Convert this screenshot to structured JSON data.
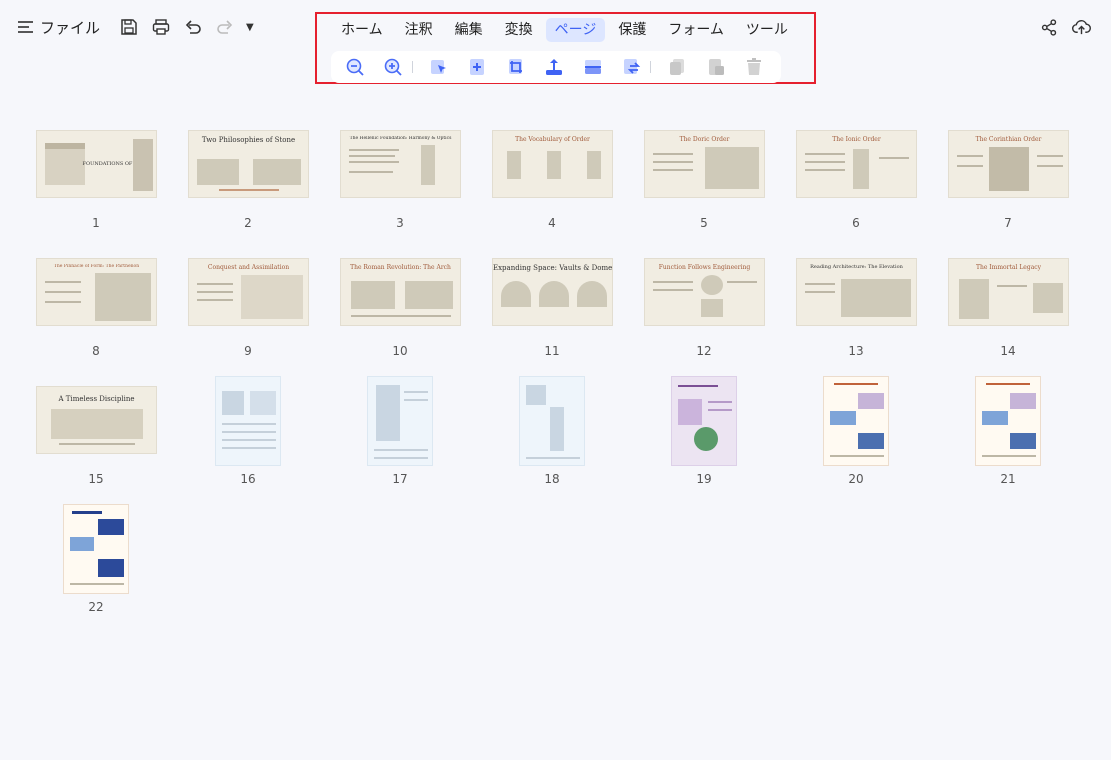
{
  "toolbar": {
    "file_label": "ファイル",
    "icons": [
      "save-icon",
      "print-icon",
      "undo-icon",
      "redo-icon",
      "dropdown-caret-icon"
    ],
    "caret": "▼"
  },
  "menu": {
    "items": [
      "ホーム",
      "注釈",
      "編集",
      "変換",
      "ページ",
      "保護",
      "フォーム",
      "ツール"
    ],
    "active_index": 4
  },
  "page_tools": [
    "zoom-out-icon",
    "zoom-in-icon",
    "select-page-icon",
    "insert-page-icon",
    "crop-page-icon",
    "extract-page-icon",
    "split-page-icon",
    "replace-page-icon",
    "duplicate-page-icon",
    "copy-page-icon",
    "delete-page-icon"
  ],
  "right_tools": [
    "share-icon",
    "cloud-upload-icon"
  ],
  "colors": {
    "accent": "#3f63f4",
    "highlight": "#e5202e",
    "background": "#f6f7fb"
  },
  "pages": [
    {
      "n": "1",
      "title": "FOUNDATIONS OF FORM",
      "kind": "land"
    },
    {
      "n": "2",
      "title": "Two Philosophies of Stone",
      "kind": "land"
    },
    {
      "n": "3",
      "title": "The Hellenic Foundation: Harmony & Optics",
      "kind": "land"
    },
    {
      "n": "4",
      "title": "The Vocabulary of Order",
      "kind": "land"
    },
    {
      "n": "5",
      "title": "The Doric Order",
      "kind": "land"
    },
    {
      "n": "6",
      "title": "The Ionic Order",
      "kind": "land"
    },
    {
      "n": "7",
      "title": "The Corinthian Order",
      "kind": "land"
    },
    {
      "n": "8",
      "title": "The Pinnacle of Form: The Parthenon",
      "kind": "land"
    },
    {
      "n": "9",
      "title": "Conquest and Assimilation",
      "kind": "land"
    },
    {
      "n": "10",
      "title": "The Roman Revolution: The Arch",
      "kind": "land"
    },
    {
      "n": "11",
      "title": "Expanding Space: Vaults & Domes",
      "kind": "land"
    },
    {
      "n": "12",
      "title": "Function Follows Engineering",
      "kind": "land"
    },
    {
      "n": "13",
      "title": "Reading Architecture: The Elevation",
      "kind": "land"
    },
    {
      "n": "14",
      "title": "The Immortal Legacy",
      "kind": "land"
    },
    {
      "n": "15",
      "title": "A Timeless Discipline",
      "kind": "land"
    },
    {
      "n": "16",
      "title": "",
      "kind": "blue"
    },
    {
      "n": "17",
      "title": "",
      "kind": "blue"
    },
    {
      "n": "18",
      "title": "",
      "kind": "blue"
    },
    {
      "n": "19",
      "title": "",
      "kind": "purple"
    },
    {
      "n": "20",
      "title": "",
      "kind": "white"
    },
    {
      "n": "21",
      "title": "",
      "kind": "white"
    },
    {
      "n": "22",
      "title": "",
      "kind": "white"
    }
  ]
}
